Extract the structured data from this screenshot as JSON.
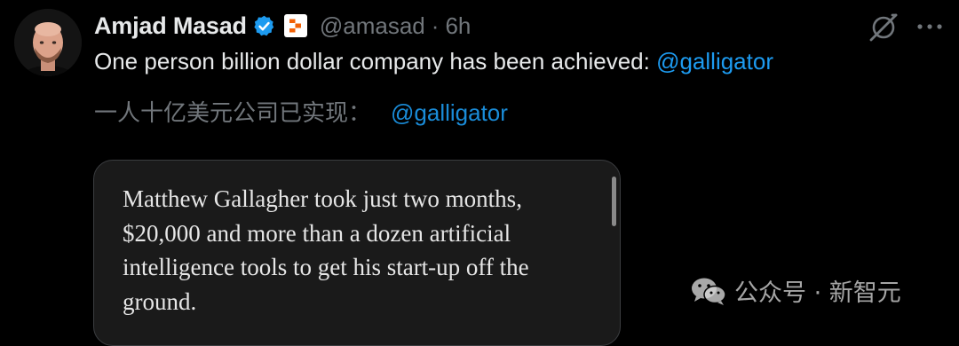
{
  "tweet": {
    "author_name": "Amjad Masad",
    "handle": "@amasad",
    "separator": "·",
    "time": "6h",
    "text_main": "One person billion dollar company has been achieved: ",
    "text_mention": "@galligator",
    "translation_main": "一人十亿美元公司已实现：",
    "translation_mention": "@galligator"
  },
  "quote": {
    "text": "Matthew Gallagher took just two months, $20,000 and more than a dozen artificial intelligence tools to get his start-up off the ground."
  },
  "watermark": {
    "text": "公众号 · 新智元"
  },
  "icons": [
    "verified-icon",
    "affiliate-badge-icon",
    "grok-icon",
    "more-icon",
    "wechat-icon"
  ],
  "colors": {
    "background": "#000000",
    "text": "#e7e9ea",
    "muted": "#71767b",
    "link": "#1d9bf0",
    "verified": "#1d9bf0",
    "affiliate_accent": "#f26207",
    "quote_bg": "#1a1a1a"
  }
}
